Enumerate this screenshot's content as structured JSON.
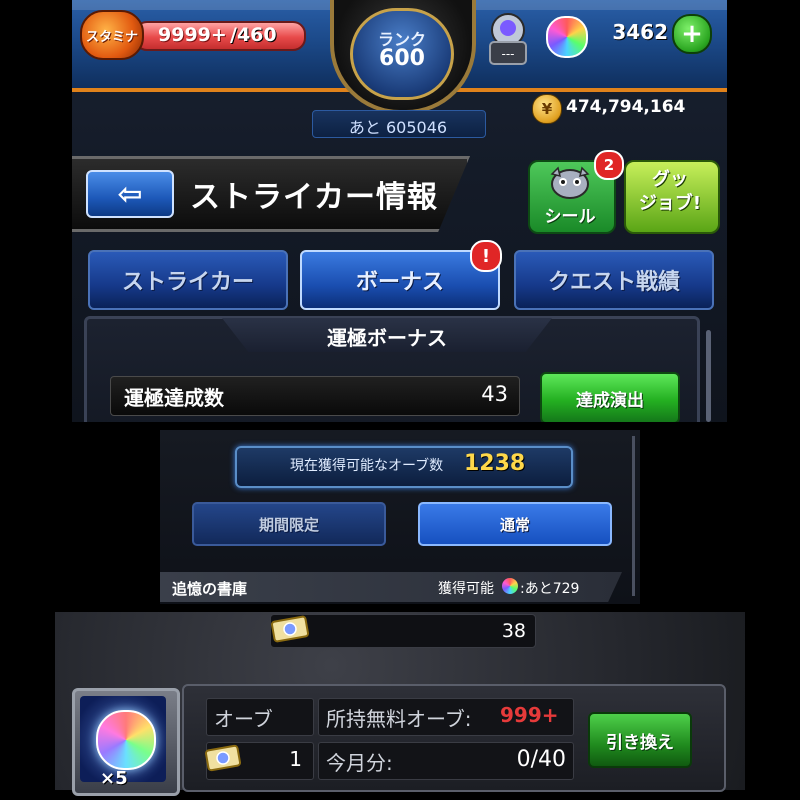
{
  "hud": {
    "stamina_label": "スタミナ",
    "stamina_value": "9999+",
    "stamina_max": "/460",
    "rank_label": "ランク",
    "rank_value": "600",
    "exp_remaining": "あと 605046",
    "egg_label": "---",
    "orb_count": "3462",
    "plus_label": "+",
    "coin_icon": "coin-icon",
    "coin_count": "474,794,164"
  },
  "header": {
    "back_icon": "back-arrow-icon",
    "back_glyph": "⇦",
    "title": "ストライカー情報",
    "seal_label": "シール",
    "seal_badge": "2",
    "goods_label": "グッ\nジョブ!"
  },
  "tabs": [
    {
      "label": "ストライカー",
      "active": false
    },
    {
      "label": "ボーナス",
      "active": true,
      "alert": "!"
    },
    {
      "label": "クエスト戦績",
      "active": false
    }
  ],
  "section": {
    "title": "運極ボーナス",
    "stat_label": "運極達成数",
    "stat_value": "43",
    "achieve_button": "達成演出"
  },
  "orb_panel": {
    "available_label": "現在獲得可能なオーブ数",
    "available_value": "1238",
    "subtabs": [
      {
        "label": "期間限定",
        "active": false
      },
      {
        "label": "通常",
        "active": true
      }
    ],
    "item": {
      "name": "追憶の書庫",
      "available_prefix": "獲得可能",
      "available_rest": ":あと729"
    }
  },
  "exchange": {
    "ticket_count": "38",
    "orb_multiplier": "×5",
    "orb_label": "オーブ",
    "owned_free_label": "所持無料オーブ:",
    "owned_free_value": "999+",
    "ticket_owned": "1",
    "month_label": "今月分:",
    "month_value": "0/40",
    "exchange_button": "引き換え"
  },
  "colors": {
    "accent_orange": "#e0821b",
    "tab_blue": "#1a4eb0",
    "button_green": "#24b021",
    "alert_red": "#e02626",
    "orb_value_yellow": "#ffd84a",
    "owned_value_red": "#e63a3a"
  }
}
